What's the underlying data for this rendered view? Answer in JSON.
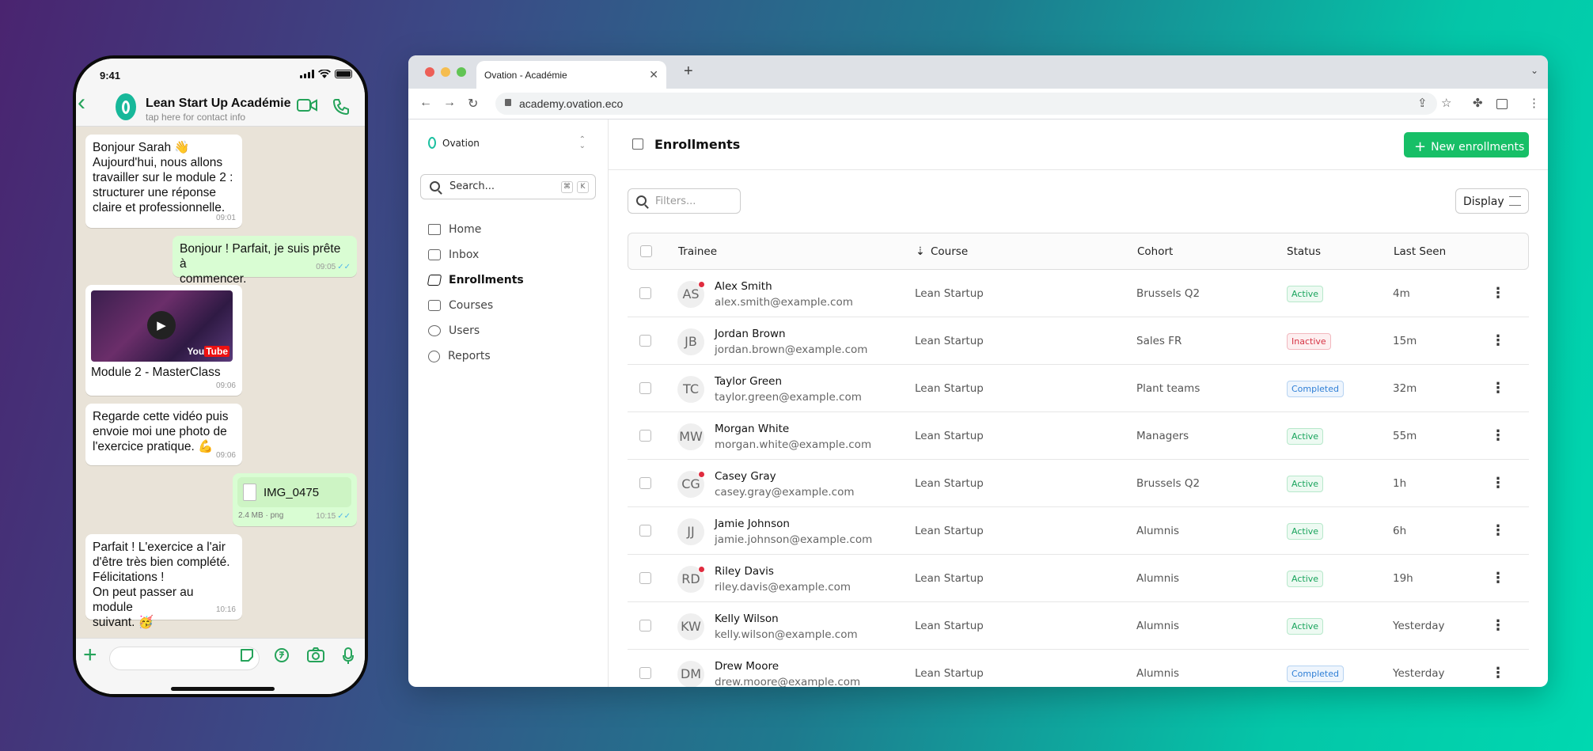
{
  "phone": {
    "time": "9:41",
    "contact_name": "Lean Start Up Académie",
    "contact_sub": "tap here for contact info",
    "messages": [
      {
        "text1": "Bonjour Sarah 👋",
        "text2": "Aujourd'hui, nous allons",
        "text3": "travailler sur le module 2 :",
        "text4": "structurer une réponse",
        "text5": "claire et professionnelle.",
        "time": "09:01"
      },
      {
        "text1": "Bonjour ! Parfait, je suis prête à",
        "text2": "commencer.",
        "time": "09:05"
      },
      {
        "caption": "Module 2 - MasterClass",
        "yt_you": "You",
        "yt_tube": "Tube",
        "time": "09:06"
      },
      {
        "text1": "Regarde cette vidéo puis",
        "text2": "envoie moi une photo de",
        "text3": "l'exercice pratique. 💪",
        "time": "09:06"
      },
      {
        "file": "IMG_0475",
        "meta": "2.4 MB · png",
        "time": "10:15"
      },
      {
        "text1": "Parfait ! L'exercice a l'air",
        "text2": "d'être très bien complété.",
        "text3": "Félicitations !",
        "text4": "On peut passer au module",
        "text5": "suivant. 🥳",
        "time": "10:16"
      }
    ]
  },
  "browser": {
    "tab_title": "Ovation - Académie",
    "url": "academy.ovation.eco",
    "colors": {
      "accent": "#17bf67",
      "brand": "#1cc0a0"
    }
  },
  "sidebar": {
    "org": "Ovation",
    "search_placeholder": "Search...",
    "kbd1": "⌘",
    "kbd2": "K",
    "items": [
      {
        "label": "Home",
        "icon": "home-icon"
      },
      {
        "label": "Inbox",
        "icon": "inbox-icon"
      },
      {
        "label": "Enrollments",
        "icon": "graduation-cap-icon"
      },
      {
        "label": "Courses",
        "icon": "book-icon"
      },
      {
        "label": "Users",
        "icon": "users-icon"
      },
      {
        "label": "Reports",
        "icon": "pie-chart-icon"
      }
    ]
  },
  "main": {
    "title": "Enrollments",
    "new_button": "New enrollments",
    "filters_placeholder": "Filters...",
    "display_button": "Display",
    "columns": [
      "Trainee",
      "Course",
      "Cohort",
      "Status",
      "Last Seen"
    ],
    "rows": [
      {
        "initials": "AS",
        "name": "Alex Smith",
        "email": "alex.smith@example.com",
        "course": "Lean Startup",
        "cohort": "Brussels Q2",
        "status": "Active",
        "last_seen": "4m"
      },
      {
        "initials": "JB",
        "name": "Jordan Brown",
        "email": "jordan.brown@example.com",
        "course": "Lean Startup",
        "cohort": "Sales FR",
        "status": "Inactive",
        "last_seen": "15m"
      },
      {
        "initials": "TC",
        "name": "Taylor Green",
        "email": "taylor.green@example.com",
        "course": "Lean Startup",
        "cohort": "Plant teams",
        "status": "Completed",
        "last_seen": "32m"
      },
      {
        "initials": "MW",
        "name": "Morgan White",
        "email": "morgan.white@example.com",
        "course": "Lean Startup",
        "cohort": "Managers",
        "status": "Active",
        "last_seen": "55m"
      },
      {
        "initials": "CG",
        "name": "Casey Gray",
        "email": "casey.gray@example.com",
        "course": "Lean Startup",
        "cohort": "Brussels Q2",
        "status": "Active",
        "last_seen": "1h"
      },
      {
        "initials": "JJ",
        "name": "Jamie Johnson",
        "email": "jamie.johnson@example.com",
        "course": "Lean Startup",
        "cohort": "Alumnis",
        "status": "Active",
        "last_seen": "6h"
      },
      {
        "initials": "RD",
        "name": "Riley Davis",
        "email": "riley.davis@example.com",
        "course": "Lean Startup",
        "cohort": "Alumnis",
        "status": "Active",
        "last_seen": "19h"
      },
      {
        "initials": "KW",
        "name": "Kelly Wilson",
        "email": "kelly.wilson@example.com",
        "course": "Lean Startup",
        "cohort": "Alumnis",
        "status": "Active",
        "last_seen": "Yesterday"
      },
      {
        "initials": "DM",
        "name": "Drew Moore",
        "email": "drew.moore@example.com",
        "course": "Lean Startup",
        "cohort": "Alumnis",
        "status": "Completed",
        "last_seen": "Yesterday"
      }
    ]
  }
}
